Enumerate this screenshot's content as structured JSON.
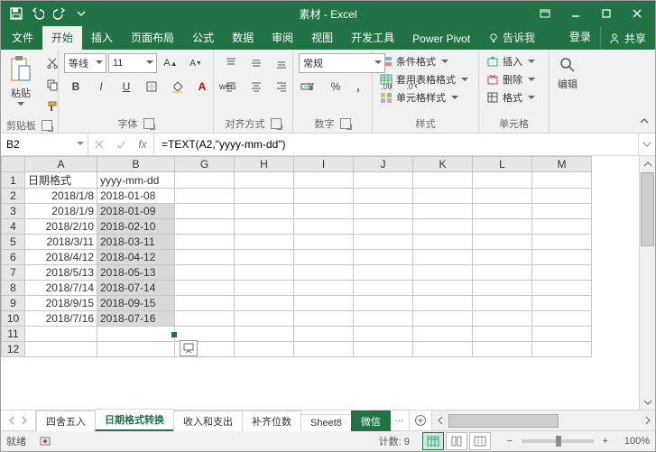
{
  "title_bar": {
    "app_title": "素材 - Excel"
  },
  "tabs": {
    "file": "文件",
    "list": [
      "开始",
      "插入",
      "页面布局",
      "公式",
      "数据",
      "审阅",
      "视图",
      "开发工具",
      "Power Pivot"
    ],
    "active_index": 0,
    "tell_me": "告诉我",
    "sign_in": "登录",
    "share": "共享"
  },
  "ribbon": {
    "clipboard": {
      "paste": "粘贴",
      "group_label": "剪贴板"
    },
    "font": {
      "font_name": "等线",
      "font_size": "11",
      "bold": "B",
      "italic": "I",
      "underline": "U",
      "ruby": "wén",
      "group_label": "字体"
    },
    "alignment": {
      "general": "常规",
      "group_label": "对齐方式"
    },
    "number": {
      "format": "常规",
      "percent": "%",
      "comma": "，",
      "group_label": "数字"
    },
    "styles": {
      "conditional": "条件格式",
      "table_format": "套用表格格式",
      "cell_styles": "单元格样式",
      "group_label": "样式"
    },
    "cells": {
      "insert": "插入",
      "delete": "删除",
      "format": "格式",
      "group_label": "单元格"
    },
    "editing": {
      "label": "编辑"
    }
  },
  "formula_bar": {
    "name_box": "B2",
    "fx_label": "fx",
    "formula": "=TEXT(A2,\"yyyy-mm-dd\")"
  },
  "grid": {
    "columns": [
      "A",
      "B",
      "G",
      "H",
      "I",
      "J",
      "K",
      "L",
      "M"
    ],
    "col_widths": {
      "row": 26,
      "A": 80,
      "B": 86,
      "other": 66
    },
    "selected_col_index": 1,
    "rows": [
      {
        "n": 1,
        "A": "日期格式",
        "B": "yyyy-mm-dd"
      },
      {
        "n": 2,
        "A": "2018/1/8",
        "B": "2018-01-08"
      },
      {
        "n": 3,
        "A": "2018/1/9",
        "B": "2018-01-09"
      },
      {
        "n": 4,
        "A": "2018/2/10",
        "B": "2018-02-10"
      },
      {
        "n": 5,
        "A": "2018/3/11",
        "B": "2018-03-11"
      },
      {
        "n": 6,
        "A": "2018/4/12",
        "B": "2018-04-12"
      },
      {
        "n": 7,
        "A": "2018/5/13",
        "B": "2018-05-13"
      },
      {
        "n": 8,
        "A": "2018/7/14",
        "B": "2018-07-14"
      },
      {
        "n": 9,
        "A": "2018/9/15",
        "B": "2018-09-15"
      },
      {
        "n": 10,
        "A": "2018/7/16",
        "B": "2018-07-16"
      },
      {
        "n": 11,
        "A": "",
        "B": ""
      },
      {
        "n": 12,
        "A": "",
        "B": ""
      }
    ],
    "selection": {
      "col": "B",
      "row_start": 2,
      "row_end": 10,
      "active": "B2"
    }
  },
  "sheet_tabs": {
    "list": [
      "四舍五入",
      "日期格式转换",
      "收入和支出",
      "补齐位数",
      "Sheet8"
    ],
    "truncated": "微信",
    "active_index": 1,
    "more": "..."
  },
  "status_bar": {
    "mode": "就绪",
    "macro_icon": "rec",
    "count_label": "计数:",
    "count_value": "9",
    "zoom_value": "100%",
    "zoom_plus": "+",
    "zoom_minus": "−"
  }
}
